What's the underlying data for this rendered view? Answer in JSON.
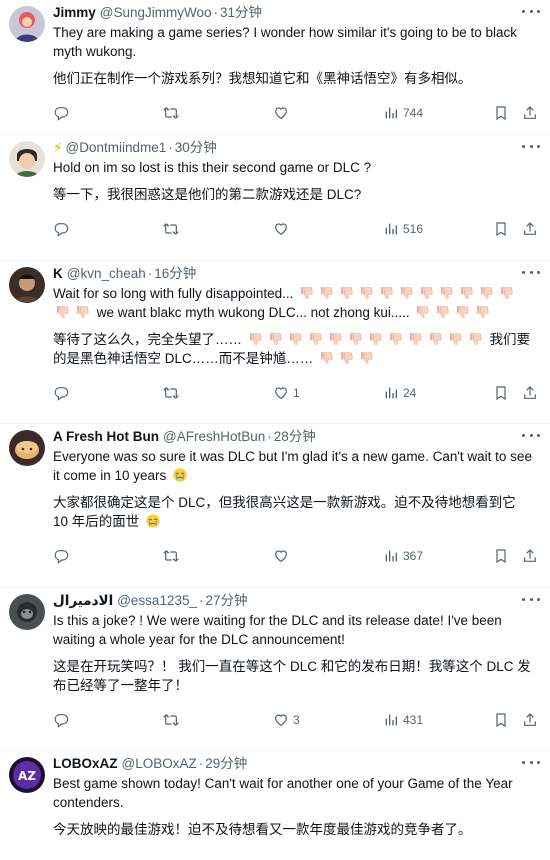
{
  "tweets": [
    {
      "name": "Jimmy",
      "handle": "@SungJimmyWoo",
      "time": "31分钟",
      "text": "They are making a game series? I wonder how similar it's going to be to black myth wukong.",
      "translation": "他们正在制作一个游戏系列？我想知道它和《黑神话悟空》有多相似。",
      "replies": "",
      "retweets": "",
      "likes": "",
      "views": "744"
    },
    {
      "name": "",
      "handle": "@Dontmiindme1",
      "time": "30分钟",
      "text": "Hold on im so lost is this their second game or DLC ?",
      "translation": "等一下，我很困惑这是他们的第二款游戏还是 DLC?",
      "replies": "",
      "retweets": "",
      "likes": "",
      "views": "516"
    },
    {
      "name": "K",
      "handle": "@kvn_cheah",
      "time": "16分钟",
      "text_a": "Wait for so long with fully disappointed...",
      "text_b": "we want blakc myth wukong DLC... not zhong kui.....",
      "trans_a": "等待了这么久，完全失望了……",
      "trans_b": "我们要的是黑色神话悟空 DLC……而不是钟馗……",
      "replies": "",
      "retweets": "",
      "likes": "1",
      "views": "24"
    },
    {
      "name": "A Fresh Hot Bun",
      "handle": "@AFreshHotBun",
      "time": "28分钟",
      "text": "Everyone was so sure it was DLC but I'm glad it's a new game. Can't wait to see it come in 10 years",
      "translation": "大家都很确定这是个 DLC，但我很高兴这是一款新游戏。迫不及待地想看到它 10 年后的面世",
      "replies": "",
      "retweets": "",
      "likes": "",
      "views": "367"
    },
    {
      "name": "الادميرال",
      "handle": "@essa1235_",
      "time": "27分钟",
      "text": "Is this a joke? ! We were waiting for the DLC and its release date! I've been waiting a whole year for the DLC announcement!",
      "translation": "这是在开玩笑吗？！ 我们一直在等这个 DLC 和它的发布日期！我等这个 DLC 发布已经等了一整年了！",
      "replies": "",
      "retweets": "",
      "likes": "3",
      "views": "431"
    },
    {
      "name": "LOBOxAZ",
      "handle": "@LOBOxAZ",
      "time": "29分钟",
      "text": "Best game shown today! Can't wait for another one of your Game of the Year contenders.",
      "translation": "今天放映的最佳游戏！迫不及待想看又一款年度最佳游戏的竞争者了。"
    }
  ],
  "dot": "·",
  "colors": {
    "secondary": "#536471",
    "text": "#0f1419",
    "divider": "#eff3f4"
  },
  "icons": [
    "reply-icon",
    "retweet-icon",
    "like-icon",
    "views-icon",
    "bookmark-icon",
    "share-icon",
    "more-icon",
    "lightning-icon",
    "thumbs-down-icon",
    "crying-face-icon"
  ]
}
